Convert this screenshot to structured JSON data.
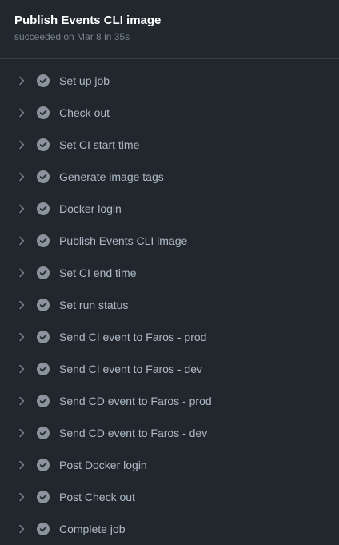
{
  "job": {
    "title": "Publish Events CLI image",
    "status_line": "succeeded on Mar 8 in 35s"
  },
  "colors": {
    "background": "#22272e",
    "check_circle": "#8b949e",
    "check_mark": "#22272e",
    "chevron": "#768390",
    "title": "#ffffff",
    "subtitle": "#768390",
    "label": "#adbac7"
  },
  "icons": {
    "expand": "chevron-right-icon",
    "status": "check-circle-icon"
  },
  "steps": [
    {
      "label": "Set up job",
      "status": "success"
    },
    {
      "label": "Check out",
      "status": "success"
    },
    {
      "label": "Set CI start time",
      "status": "success"
    },
    {
      "label": "Generate image tags",
      "status": "success"
    },
    {
      "label": "Docker login",
      "status": "success"
    },
    {
      "label": "Publish Events CLI image",
      "status": "success"
    },
    {
      "label": "Set CI end time",
      "status": "success"
    },
    {
      "label": "Set run status",
      "status": "success"
    },
    {
      "label": "Send CI event to Faros - prod",
      "status": "success"
    },
    {
      "label": "Send CI event to Faros - dev",
      "status": "success"
    },
    {
      "label": "Send CD event to Faros - prod",
      "status": "success"
    },
    {
      "label": "Send CD event to Faros - dev",
      "status": "success"
    },
    {
      "label": "Post Docker login",
      "status": "success"
    },
    {
      "label": "Post Check out",
      "status": "success"
    },
    {
      "label": "Complete job",
      "status": "success"
    }
  ]
}
